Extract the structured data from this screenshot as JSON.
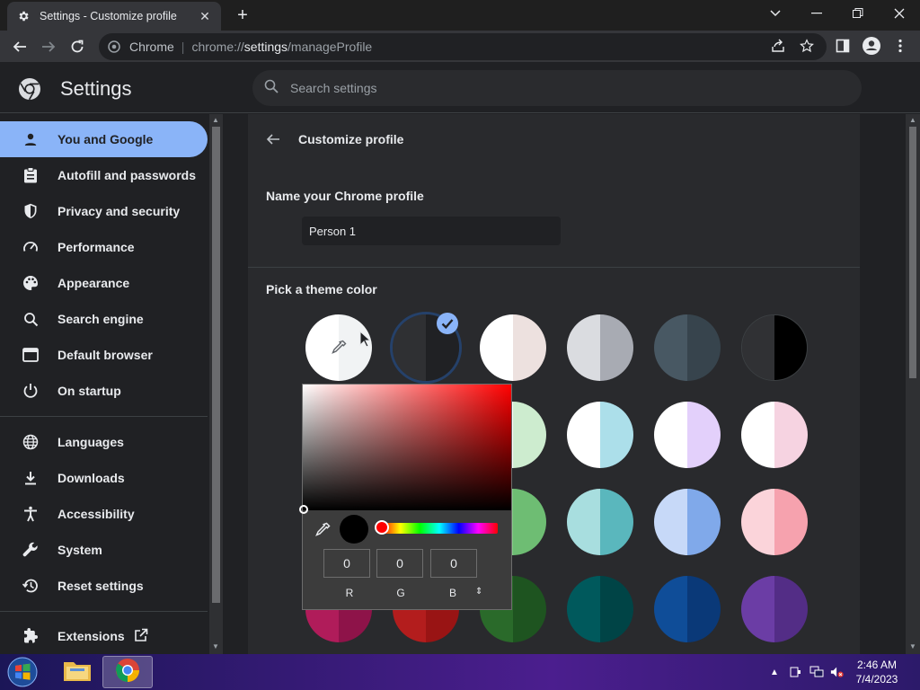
{
  "browser": {
    "tab_title": "Settings - Customize profile",
    "chip_label": "Chrome",
    "url_scheme": "chrome://",
    "url_host": "settings",
    "url_path": "/manageProfile"
  },
  "header": {
    "title": "Settings",
    "search_placeholder": "Search settings"
  },
  "sidebar": {
    "items": [
      {
        "label": "You and Google",
        "icon": "person-icon"
      },
      {
        "label": "Autofill and passwords",
        "icon": "clipboard-icon"
      },
      {
        "label": "Privacy and security",
        "icon": "shield-icon"
      },
      {
        "label": "Performance",
        "icon": "speedometer-icon"
      },
      {
        "label": "Appearance",
        "icon": "palette-icon"
      },
      {
        "label": "Search engine",
        "icon": "search-icon"
      },
      {
        "label": "Default browser",
        "icon": "browser-window-icon"
      },
      {
        "label": "On startup",
        "icon": "power-icon"
      },
      {
        "label": "Languages",
        "icon": "globe-icon"
      },
      {
        "label": "Downloads",
        "icon": "download-icon"
      },
      {
        "label": "Accessibility",
        "icon": "accessibility-icon"
      },
      {
        "label": "System",
        "icon": "wrench-icon"
      },
      {
        "label": "Reset settings",
        "icon": "history-icon"
      },
      {
        "label": "Extensions",
        "icon": "puzzle-icon"
      }
    ]
  },
  "main": {
    "page_title": "Customize profile",
    "name_label": "Name your Chrome profile",
    "name_value": "Person 1",
    "theme_label": "Pick a theme color",
    "swatches": [
      [
        "#ffffff",
        "#f1f3f4"
      ],
      [
        "#2f3033",
        "#202124"
      ],
      [
        "#ffffff",
        "#ede1df"
      ],
      [
        "#dadce0",
        "#a8abb3"
      ],
      [
        "#485863",
        "#37444d"
      ],
      [
        "#303134",
        "#000000"
      ],
      [
        "#ffffff",
        "#cdeccf"
      ],
      [
        "#ffffff",
        "#acdfea"
      ],
      [
        "#ffffff",
        "#e3d0fb"
      ],
      [
        "#ffffff",
        "#f6d3e1"
      ],
      [
        "#88cc8a",
        "#6ebd73"
      ],
      [
        "#a8dedf",
        "#5ab7bd"
      ],
      [
        "#c7d9f8",
        "#80a9ea"
      ],
      [
        "#fbd4da",
        "#f6a2ae"
      ],
      [
        "#b01c5a",
        "#8e1349"
      ],
      [
        "#b31d1d",
        "#991414"
      ],
      [
        "#2a6a2a",
        "#1e5420"
      ],
      [
        "#00595c",
        "#004446"
      ],
      [
        "#0f4d98",
        "#0a3978"
      ],
      [
        "#6b3da5",
        "#532d86"
      ]
    ]
  },
  "color_picker": {
    "r": "0",
    "g": "0",
    "b": "0",
    "r_label": "R",
    "g_label": "G",
    "b_label": "B",
    "format_toggle": "⇕"
  },
  "taskbar": {
    "time": "2:46 AM",
    "date": "7/4/2023"
  },
  "colors": {
    "accent": "#8ab4f8",
    "background": "#202124",
    "card": "#292a2d"
  }
}
